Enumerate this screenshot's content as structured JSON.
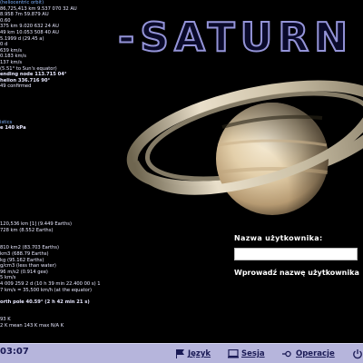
{
  "info_panel": {
    "lines": [
      {
        "text": "(heliocentric orbit)",
        "style": "head"
      },
      {
        "text": "86,725,413 km 9.537 070 32 AU",
        "style": ""
      },
      {
        "text": "  8.958 7m 59.879 AU",
        "style": ""
      },
      {
        "text": "0.60",
        "style": ""
      },
      {
        "text": "375 km 9.020 632 24 AU",
        "style": ""
      },
      {
        "text": "49 km 10.053 508 40 AU",
        "style": ""
      },
      {
        "text": "5.1999 d (29.45 a)",
        "style": ""
      },
      {
        "text": "0 d",
        "style": ""
      },
      {
        "text": "639 km/s",
        "style": ""
      },
      {
        "text": "0.183 km/s",
        "style": ""
      },
      {
        "text": "137 km/s",
        "style": ""
      },
      {
        "text": "(5.51° to Sun's equator)",
        "style": ""
      },
      {
        "text": "ending node  113.715 04°",
        "style": "b"
      },
      {
        "text": "helion  336.716 90°",
        "style": "b"
      },
      {
        "text": "  49 confirmed",
        "style": ""
      },
      {
        "text": "",
        "style": ""
      },
      {
        "text": "",
        "style": ""
      },
      {
        "text": "",
        "style": ""
      },
      {
        "text": "",
        "style": ""
      },
      {
        "text": "",
        "style": ""
      },
      {
        "text": "istics",
        "style": "head"
      },
      {
        "text": "e  140 kPa",
        "style": "b"
      },
      {
        "text": "",
        "style": ""
      },
      {
        "text": "",
        "style": ""
      },
      {
        "text": "",
        "style": ""
      },
      {
        "text": "",
        "style": ""
      },
      {
        "text": "",
        "style": ""
      },
      {
        "text": "",
        "style": ""
      },
      {
        "text": "",
        "style": ""
      },
      {
        "text": "",
        "style": ""
      },
      {
        "text": "",
        "style": ""
      },
      {
        "text": "",
        "style": ""
      },
      {
        "text": "",
        "style": ""
      },
      {
        "text": "",
        "style": ""
      },
      {
        "text": "",
        "style": ""
      },
      {
        "text": "",
        "style": ""
      },
      {
        "text": "",
        "style": "head"
      },
      {
        "text": "120,536 km [1] (9.449 Earths)",
        "style": ""
      },
      {
        "text": "728 km (8.552 Earths)",
        "style": ""
      },
      {
        "text": "",
        "style": ""
      },
      {
        "text": "",
        "style": ""
      },
      {
        "text": "810 km2 (83.703 Earths)",
        "style": ""
      },
      {
        "text": "km3 (688.79 Earths)",
        "style": ""
      },
      {
        "text": "kg (95.162 Earths)",
        "style": ""
      },
      {
        "text": "g/cm3 (less than water)",
        "style": ""
      },
      {
        "text": "96 m/s2 (0.914 gee)",
        "style": ""
      },
      {
        "text": "5 km/s",
        "style": ""
      },
      {
        "text": "4 009 259 2 d (10 h 39 min 22.400 00 s) 1",
        "style": ""
      },
      {
        "text": "7 km/s = 35,500 km/h (at the equator)",
        "style": ""
      },
      {
        "text": "",
        "style": ""
      },
      {
        "text": "orth pole  40.59° (2 h 42 min 21 s)",
        "style": "b"
      },
      {
        "text": "",
        "style": ""
      },
      {
        "text": "",
        "style": ""
      },
      {
        "text": "  93 K",
        "style": ""
      },
      {
        "text": "2 K  mean 143 K  max N/A K",
        "style": ""
      }
    ]
  },
  "title": "-SATURN",
  "login": {
    "username_label": "Nazwa użytkownika:",
    "username_value": "",
    "prompt": "Wprowadź nazwę użytkownika"
  },
  "taskbar": {
    "clock": "03:07",
    "language_label": "Język",
    "session_label": "Sesja",
    "operations_label": "Operacje"
  },
  "colors": {
    "taskbar_bg": "#b6b5dc",
    "title_stroke": "#9494d8",
    "title_fill": "#0a0a2a"
  }
}
